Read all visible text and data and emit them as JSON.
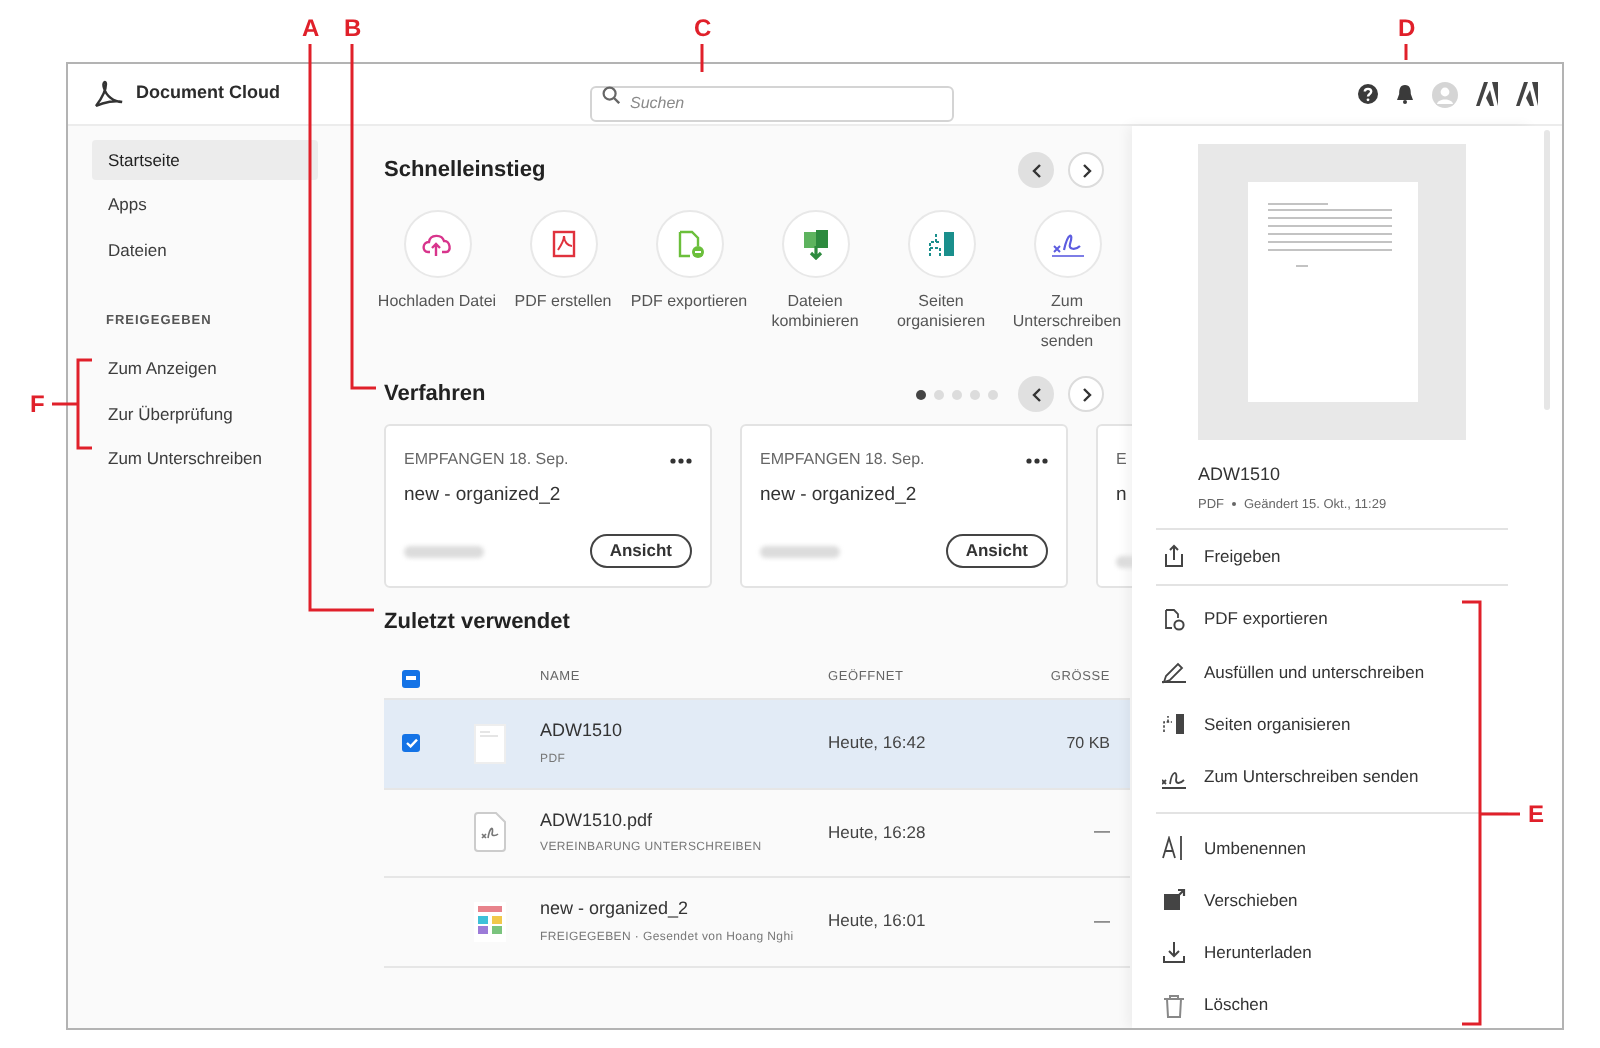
{
  "annotations": [
    {
      "label": "A"
    },
    {
      "label": "B"
    },
    {
      "label": "C"
    },
    {
      "label": "D"
    },
    {
      "label": "E"
    },
    {
      "label": "F"
    }
  ],
  "header": {
    "logo_text": "Document Cloud",
    "search": {
      "placeholder": "Suchen"
    }
  },
  "sidebar": {
    "items": [
      {
        "label": "Startseite",
        "selected": true
      },
      {
        "label": "Apps",
        "selected": false
      },
      {
        "label": "Dateien",
        "selected": false
      }
    ],
    "section_title": "FREIGEGEBEN",
    "shared_items": [
      {
        "label": "Zum Anzeigen",
        "selected": false
      },
      {
        "label": "Zur Überprüfung",
        "selected": false
      },
      {
        "label": "Zum Unterschreiben",
        "selected": false
      }
    ]
  },
  "quick_start": {
    "title": "Schnelleinstieg",
    "prev_disabled": true,
    "tools": [
      {
        "kind": "upload",
        "label": "Hochladen Datei"
      },
      {
        "kind": "create",
        "label": "PDF erstellen"
      },
      {
        "kind": "export",
        "label": "PDF exportieren"
      },
      {
        "kind": "combine",
        "label": "Dateien kombinieren"
      },
      {
        "kind": "organize",
        "label": "Seiten organisieren"
      },
      {
        "kind": "send-sign",
        "label": "Zum Unterschreiben senden"
      }
    ]
  },
  "procedures": {
    "title": "Verfahren",
    "prev_disabled": true,
    "pages": [
      {
        "selected": true
      },
      {
        "selected": false
      },
      {
        "selected": false
      },
      {
        "selected": false
      },
      {
        "selected": false
      }
    ],
    "cards": [
      {
        "status": "EMPFANGEN 18. Sep.",
        "name": "new - organized_2",
        "button": "Ansicht"
      },
      {
        "status": "EMPFANGEN 18. Sep.",
        "name": "new - organized_2",
        "button": "Ansicht"
      },
      {
        "status": "E",
        "name": "n"
      }
    ]
  },
  "recent": {
    "title": "Zuletzt verwendet",
    "columns": [
      "NAME",
      "GEÖFFNET",
      "GRÖSSE"
    ],
    "select_all": {
      "indeterminate": true
    },
    "rows": [
      {
        "kind": "page",
        "name": "ADW1510",
        "meta": "PDF",
        "opened": "Heute, 16:42",
        "size": "70 KB",
        "selected": true
      },
      {
        "kind": "sign-doc",
        "name": "ADW1510.pdf",
        "meta": "VEREINBARUNG UNTERSCHREIBEN",
        "opened": "Heute, 16:28",
        "size": "—",
        "selected": false
      },
      {
        "kind": "image",
        "name": "new - organized_2",
        "meta": "FREIGEGEBEN · Gesendet von Hoang Nghi",
        "opened": "Heute, 16:01",
        "size": "—",
        "selected": false
      }
    ]
  },
  "details": {
    "file_name": "ADW1510",
    "file_type": "PDF",
    "modified": "Geändert 15. Okt., 11:29",
    "action_groups": [
      [
        {
          "kind": "share",
          "label": "Freigeben"
        }
      ],
      [
        {
          "kind": "export",
          "label": "PDF exportieren"
        },
        {
          "kind": "fill-sign",
          "label": "Ausfüllen und unterschreiben"
        },
        {
          "kind": "organize",
          "label": "Seiten organisieren"
        },
        {
          "kind": "send-sign",
          "label": "Zum Unterschreiben senden"
        }
      ],
      [
        {
          "kind": "rename",
          "label": "Umbenennen"
        },
        {
          "kind": "move",
          "label": "Verschieben"
        },
        {
          "kind": "download",
          "label": "Herunterladen"
        },
        {
          "kind": "delete",
          "label": "Löschen"
        }
      ]
    ]
  }
}
